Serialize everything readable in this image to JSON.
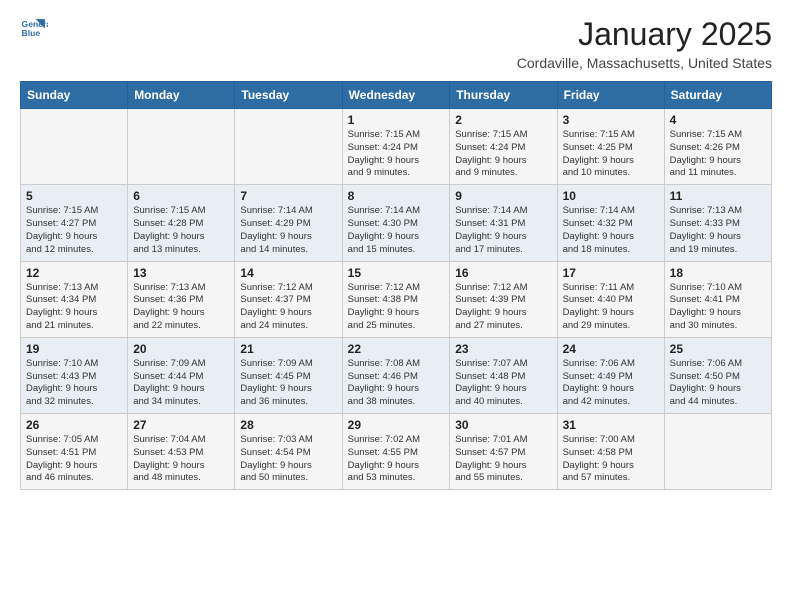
{
  "logo": {
    "line1": "General",
    "line2": "Blue"
  },
  "title": "January 2025",
  "location": "Cordaville, Massachusetts, United States",
  "weekdays": [
    "Sunday",
    "Monday",
    "Tuesday",
    "Wednesday",
    "Thursday",
    "Friday",
    "Saturday"
  ],
  "weeks": [
    [
      {
        "day": "",
        "info": ""
      },
      {
        "day": "",
        "info": ""
      },
      {
        "day": "",
        "info": ""
      },
      {
        "day": "1",
        "info": "Sunrise: 7:15 AM\nSunset: 4:24 PM\nDaylight: 9 hours\nand 9 minutes."
      },
      {
        "day": "2",
        "info": "Sunrise: 7:15 AM\nSunset: 4:24 PM\nDaylight: 9 hours\nand 9 minutes."
      },
      {
        "day": "3",
        "info": "Sunrise: 7:15 AM\nSunset: 4:25 PM\nDaylight: 9 hours\nand 10 minutes."
      },
      {
        "day": "4",
        "info": "Sunrise: 7:15 AM\nSunset: 4:26 PM\nDaylight: 9 hours\nand 11 minutes."
      }
    ],
    [
      {
        "day": "5",
        "info": "Sunrise: 7:15 AM\nSunset: 4:27 PM\nDaylight: 9 hours\nand 12 minutes."
      },
      {
        "day": "6",
        "info": "Sunrise: 7:15 AM\nSunset: 4:28 PM\nDaylight: 9 hours\nand 13 minutes."
      },
      {
        "day": "7",
        "info": "Sunrise: 7:14 AM\nSunset: 4:29 PM\nDaylight: 9 hours\nand 14 minutes."
      },
      {
        "day": "8",
        "info": "Sunrise: 7:14 AM\nSunset: 4:30 PM\nDaylight: 9 hours\nand 15 minutes."
      },
      {
        "day": "9",
        "info": "Sunrise: 7:14 AM\nSunset: 4:31 PM\nDaylight: 9 hours\nand 17 minutes."
      },
      {
        "day": "10",
        "info": "Sunrise: 7:14 AM\nSunset: 4:32 PM\nDaylight: 9 hours\nand 18 minutes."
      },
      {
        "day": "11",
        "info": "Sunrise: 7:13 AM\nSunset: 4:33 PM\nDaylight: 9 hours\nand 19 minutes."
      }
    ],
    [
      {
        "day": "12",
        "info": "Sunrise: 7:13 AM\nSunset: 4:34 PM\nDaylight: 9 hours\nand 21 minutes."
      },
      {
        "day": "13",
        "info": "Sunrise: 7:13 AM\nSunset: 4:36 PM\nDaylight: 9 hours\nand 22 minutes."
      },
      {
        "day": "14",
        "info": "Sunrise: 7:12 AM\nSunset: 4:37 PM\nDaylight: 9 hours\nand 24 minutes."
      },
      {
        "day": "15",
        "info": "Sunrise: 7:12 AM\nSunset: 4:38 PM\nDaylight: 9 hours\nand 25 minutes."
      },
      {
        "day": "16",
        "info": "Sunrise: 7:12 AM\nSunset: 4:39 PM\nDaylight: 9 hours\nand 27 minutes."
      },
      {
        "day": "17",
        "info": "Sunrise: 7:11 AM\nSunset: 4:40 PM\nDaylight: 9 hours\nand 29 minutes."
      },
      {
        "day": "18",
        "info": "Sunrise: 7:10 AM\nSunset: 4:41 PM\nDaylight: 9 hours\nand 30 minutes."
      }
    ],
    [
      {
        "day": "19",
        "info": "Sunrise: 7:10 AM\nSunset: 4:43 PM\nDaylight: 9 hours\nand 32 minutes."
      },
      {
        "day": "20",
        "info": "Sunrise: 7:09 AM\nSunset: 4:44 PM\nDaylight: 9 hours\nand 34 minutes."
      },
      {
        "day": "21",
        "info": "Sunrise: 7:09 AM\nSunset: 4:45 PM\nDaylight: 9 hours\nand 36 minutes."
      },
      {
        "day": "22",
        "info": "Sunrise: 7:08 AM\nSunset: 4:46 PM\nDaylight: 9 hours\nand 38 minutes."
      },
      {
        "day": "23",
        "info": "Sunrise: 7:07 AM\nSunset: 4:48 PM\nDaylight: 9 hours\nand 40 minutes."
      },
      {
        "day": "24",
        "info": "Sunrise: 7:06 AM\nSunset: 4:49 PM\nDaylight: 9 hours\nand 42 minutes."
      },
      {
        "day": "25",
        "info": "Sunrise: 7:06 AM\nSunset: 4:50 PM\nDaylight: 9 hours\nand 44 minutes."
      }
    ],
    [
      {
        "day": "26",
        "info": "Sunrise: 7:05 AM\nSunset: 4:51 PM\nDaylight: 9 hours\nand 46 minutes."
      },
      {
        "day": "27",
        "info": "Sunrise: 7:04 AM\nSunset: 4:53 PM\nDaylight: 9 hours\nand 48 minutes."
      },
      {
        "day": "28",
        "info": "Sunrise: 7:03 AM\nSunset: 4:54 PM\nDaylight: 9 hours\nand 50 minutes."
      },
      {
        "day": "29",
        "info": "Sunrise: 7:02 AM\nSunset: 4:55 PM\nDaylight: 9 hours\nand 53 minutes."
      },
      {
        "day": "30",
        "info": "Sunrise: 7:01 AM\nSunset: 4:57 PM\nDaylight: 9 hours\nand 55 minutes."
      },
      {
        "day": "31",
        "info": "Sunrise: 7:00 AM\nSunset: 4:58 PM\nDaylight: 9 hours\nand 57 minutes."
      },
      {
        "day": "",
        "info": ""
      }
    ]
  ]
}
